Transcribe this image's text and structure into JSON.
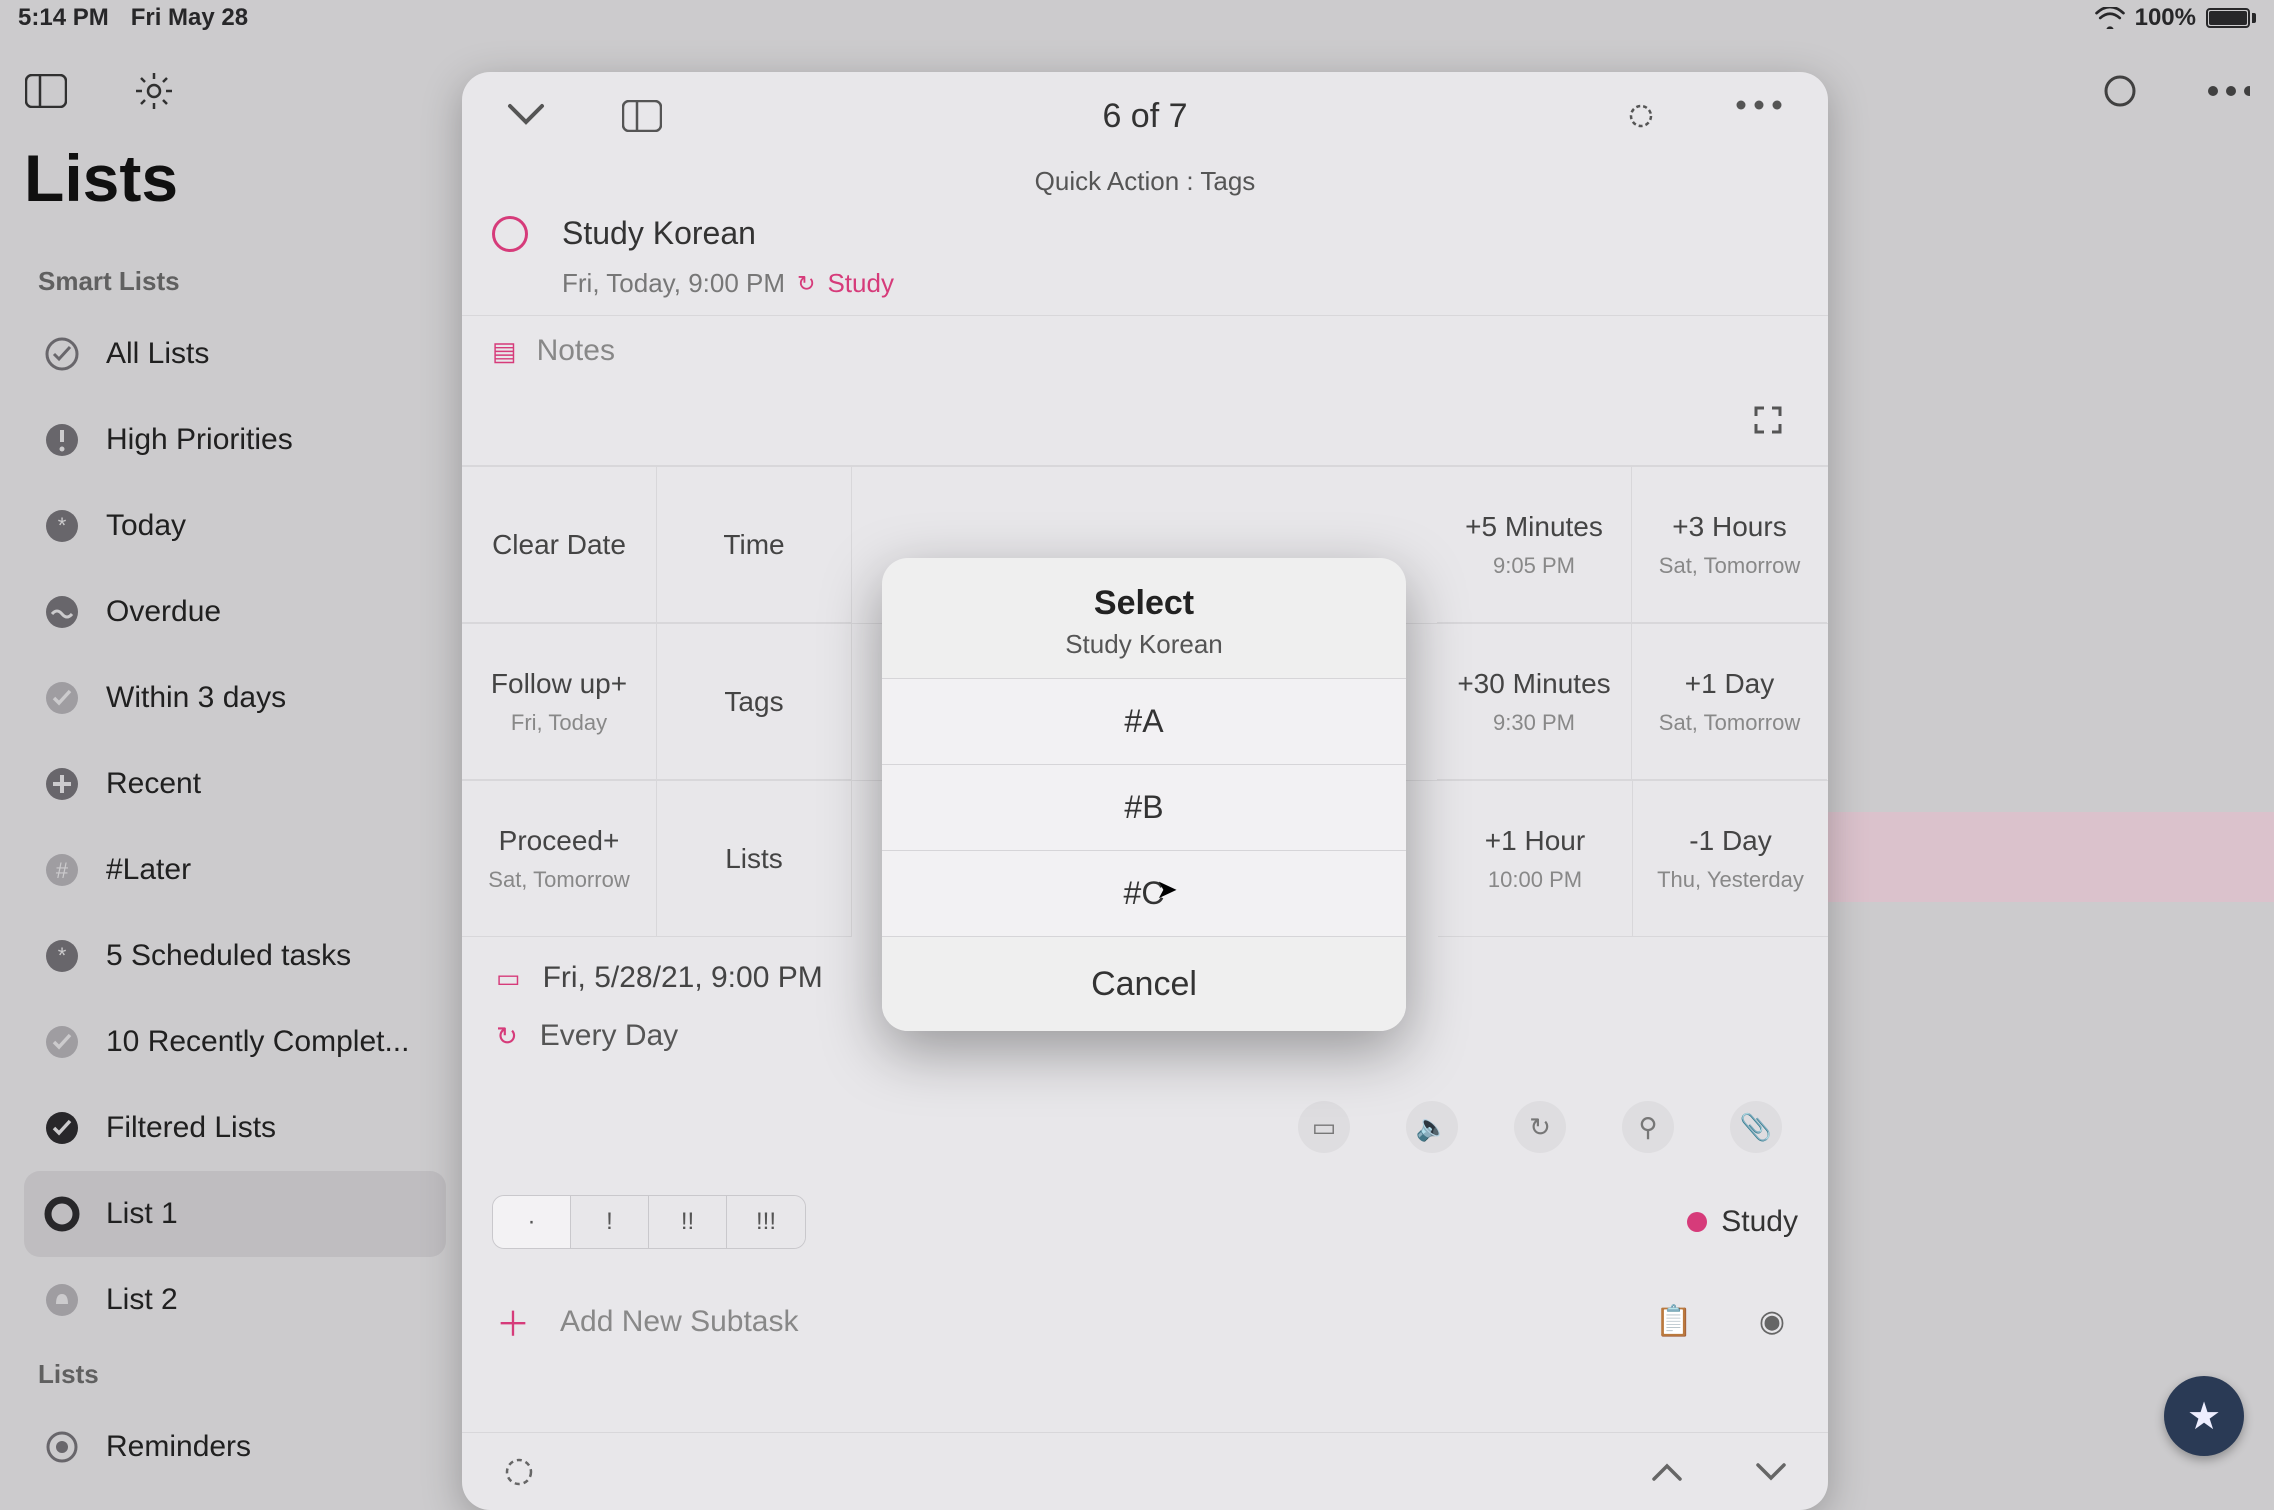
{
  "status": {
    "time": "5:14 PM",
    "date": "Fri May 28",
    "battery": "100%"
  },
  "sidebar": {
    "title": "Lists",
    "section_smart": "Smart Lists",
    "section_lists": "Lists",
    "items": [
      {
        "label": "All Lists"
      },
      {
        "label": "High Priorities"
      },
      {
        "label": "Today"
      },
      {
        "label": "Overdue"
      },
      {
        "label": "Within 3 days"
      },
      {
        "label": "Recent"
      },
      {
        "label": "#Later"
      },
      {
        "label": "5 Scheduled tasks"
      },
      {
        "label": "10 Recently Complet..."
      },
      {
        "label": "Filtered Lists"
      },
      {
        "label": "List 1"
      },
      {
        "label": "List 2"
      }
    ],
    "lists_items": [
      {
        "label": "Reminders"
      }
    ]
  },
  "card": {
    "counter": "6 of 7",
    "quick_action_label": "Quick Action : Tags",
    "task_name": "Study Korean",
    "due_text": "Fri, Today, 9:00 PM",
    "due_list": "Study",
    "notes_label": "Notes",
    "grid": {
      "r1": [
        {
          "t": "Clear Date"
        },
        {
          "t": "Time"
        },
        {
          "t": ""
        },
        {
          "t": ""
        },
        {
          "t": ""
        },
        {
          "t": "+5 Minutes",
          "s": "9:05 PM"
        },
        {
          "t": "+3 Hours",
          "s": "Sat, Tomorrow"
        }
      ],
      "r2": [
        {
          "t": "Follow up+",
          "s": "Fri, Today"
        },
        {
          "t": "Tags"
        },
        {
          "t": ""
        },
        {
          "t": ""
        },
        {
          "t": ""
        },
        {
          "t": "+30 Minutes",
          "s": "9:30 PM"
        },
        {
          "t": "+1 Day",
          "s": "Sat, Tomorrow"
        }
      ],
      "r3": [
        {
          "t": "Proceed+",
          "s": "Sat, Tomorrow"
        },
        {
          "t": "Lists"
        },
        {
          "t": ""
        },
        {
          "t": "+1 Hour",
          "s": "10:00 PM"
        },
        {
          "t": "-1 Day",
          "s": "Thu, Yesterday"
        }
      ]
    },
    "schedule_date": "Fri, 5/28/21, 9:00 PM",
    "repeat_text": "Every Day",
    "priority": {
      "p0": "·",
      "p1": "!",
      "p2": "!!",
      "p3": "!!!"
    },
    "list_pill": "Study",
    "add_subtask": "Add New Subtask"
  },
  "sheet": {
    "title": "Select",
    "subtitle": "Study Korean",
    "items": [
      "#A",
      "#B",
      "#C"
    ],
    "cancel": "Cancel"
  }
}
